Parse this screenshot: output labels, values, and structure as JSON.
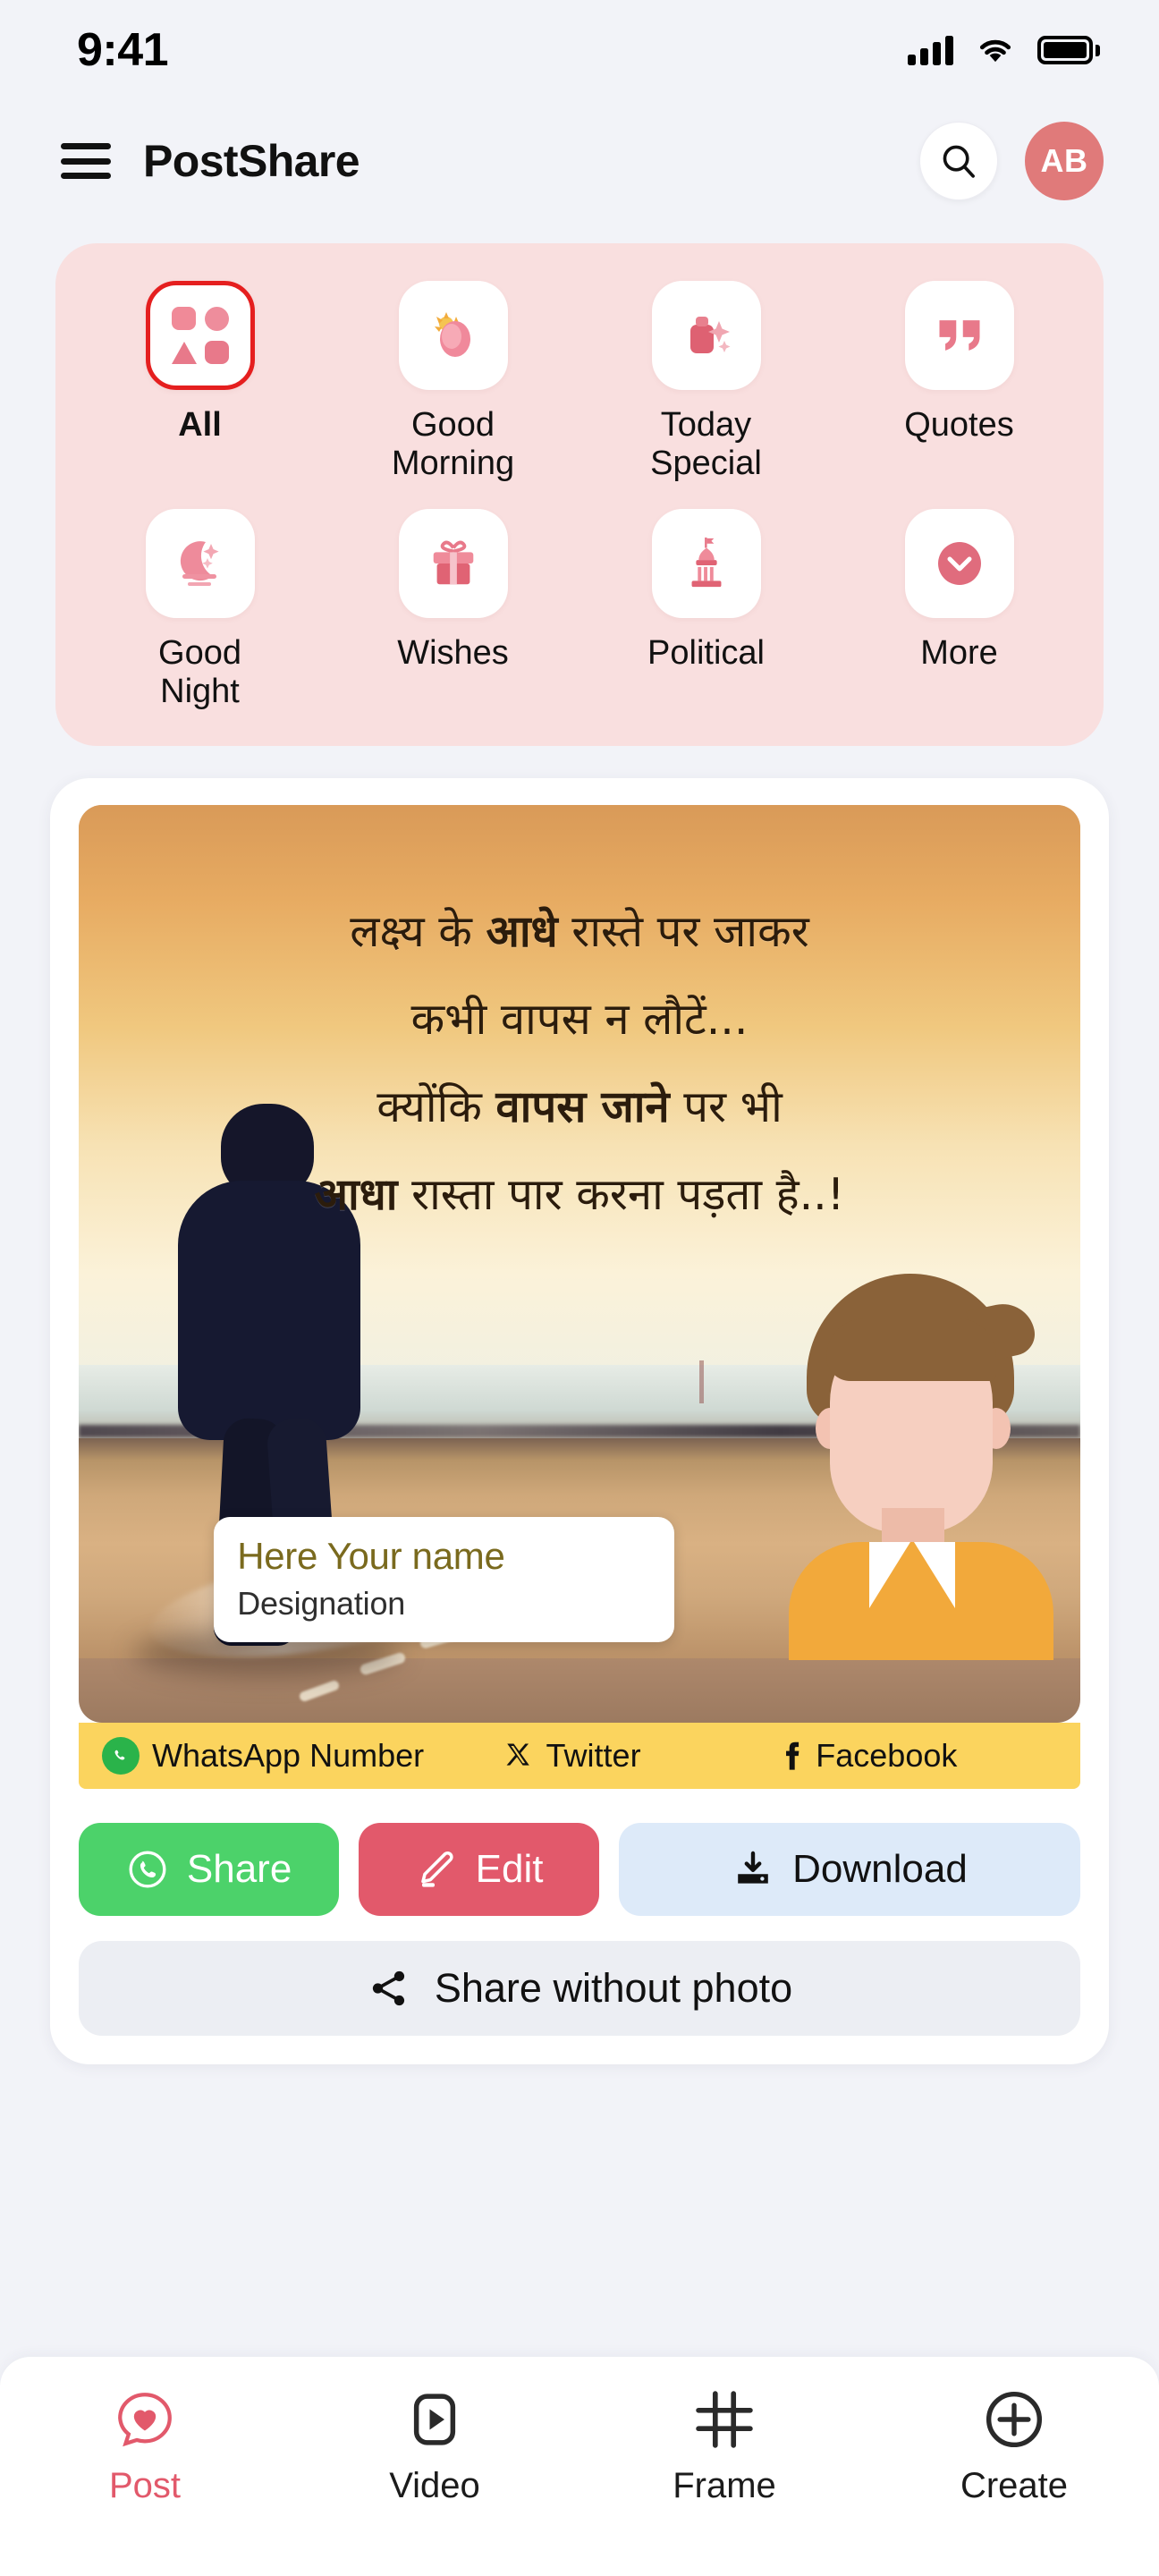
{
  "status_bar": {
    "time": "9:41",
    "signal_icon": "cellular-signal-icon",
    "wifi_icon": "wifi-icon",
    "battery_icon": "battery-full-icon"
  },
  "header": {
    "menu_icon": "hamburger-menu-icon",
    "title": "PostShare",
    "search_icon": "search-icon",
    "avatar_initials": "AB"
  },
  "categories": {
    "panel_color": "#f9dfdf",
    "selected": "All",
    "items": [
      {
        "label": "All",
        "icon": "grid-shapes-icon",
        "selected": true
      },
      {
        "label": "Good\nMorning",
        "icon": "sunrise-flower-icon",
        "selected": false
      },
      {
        "label": "Today\nSpecial",
        "icon": "gift-sparkle-icon",
        "selected": false
      },
      {
        "label": "Quotes",
        "icon": "quotation-marks-icon",
        "selected": false
      },
      {
        "label": "Good\nNight",
        "icon": "moon-stars-icon",
        "selected": false
      },
      {
        "label": "Wishes",
        "icon": "gift-box-icon",
        "selected": false
      },
      {
        "label": "Political",
        "icon": "capitol-building-icon",
        "selected": false
      },
      {
        "label": "More",
        "icon": "chevron-down-circle-icon",
        "selected": false
      }
    ]
  },
  "poster": {
    "quote_lines": [
      {
        "parts": [
          {
            "t": "लक्ष्य के ",
            "b": false
          },
          {
            "t": "आधे",
            "b": true
          },
          {
            "t": " रास्ते पर जाकर",
            "b": false
          }
        ]
      },
      {
        "parts": [
          {
            "t": "कभी वापस न लौटें...",
            "b": false
          }
        ]
      },
      {
        "parts": [
          {
            "t": "क्योंकि ",
            "b": false
          },
          {
            "t": "वापस जाने",
            "b": true
          },
          {
            "t": " पर भी",
            "b": false
          }
        ]
      },
      {
        "parts": [
          {
            "t": "आधा",
            "b": true
          },
          {
            "t": " रास्ता पार करना पड़ता है..!",
            "b": false
          }
        ]
      }
    ],
    "name_card": {
      "name": "Here Your name",
      "designation": "Designation",
      "name_color": "#7a6a1e"
    },
    "social_bar": {
      "background": "#fbd45e",
      "items": [
        {
          "label": "WhatsApp Number",
          "icon": "whatsapp-icon"
        },
        {
          "label": "Twitter",
          "icon": "x-twitter-icon"
        },
        {
          "label": "Facebook",
          "icon": "facebook-icon"
        }
      ]
    }
  },
  "actions": {
    "share": {
      "label": "Share",
      "icon": "whatsapp-icon",
      "color": "#4cd26a"
    },
    "edit": {
      "label": "Edit",
      "icon": "pencil-edit-icon",
      "color": "#e2596b"
    },
    "download": {
      "label": "Download",
      "icon": "download-icon",
      "color": "#ddeaf9"
    },
    "share_without_photo": {
      "label": "Share without photo",
      "icon": "share-nodes-icon"
    }
  },
  "bottom_nav": {
    "active": "Post",
    "active_color": "#e2596b",
    "items": [
      {
        "label": "Post",
        "icon": "heart-post-icon",
        "active": true
      },
      {
        "label": "Video",
        "icon": "video-play-icon",
        "active": false
      },
      {
        "label": "Frame",
        "icon": "frame-crop-icon",
        "active": false
      },
      {
        "label": "Create",
        "icon": "plus-circle-icon",
        "active": false
      }
    ]
  }
}
